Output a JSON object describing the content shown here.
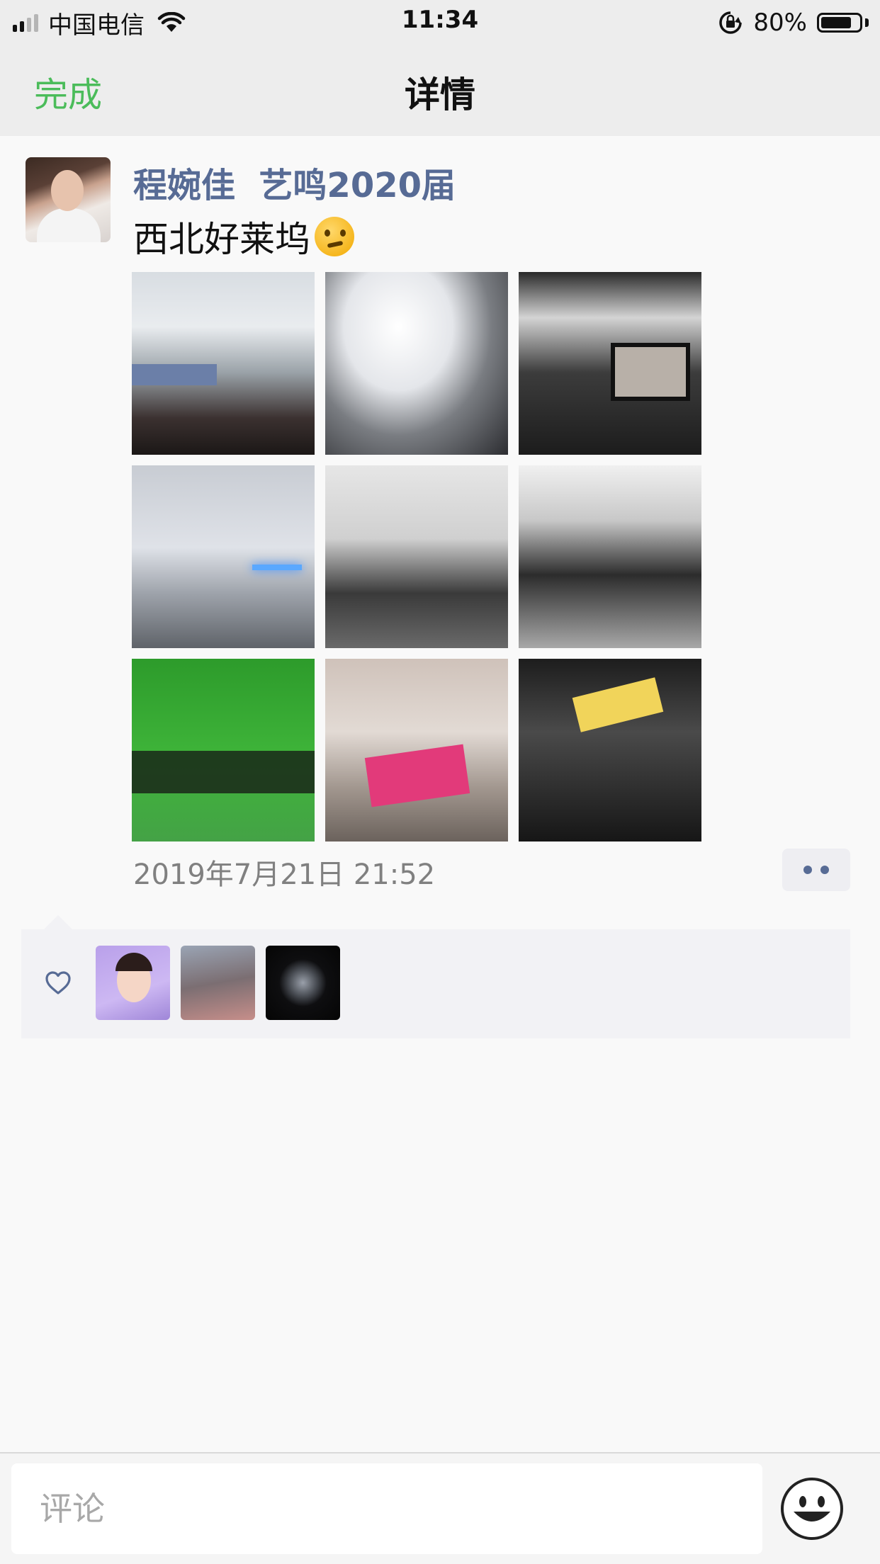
{
  "status_bar": {
    "carrier": "中国电信",
    "time": "11:34",
    "battery": "80%",
    "battery_level": 0.8,
    "icons": [
      "signal-icon",
      "wifi-icon",
      "orientation-lock-icon",
      "battery-icon"
    ]
  },
  "nav": {
    "done": "完成",
    "title": "详情",
    "done_color": "#4bbc5a"
  },
  "post": {
    "author": "程婉佳  艺鸣2020届",
    "author_color": "#576b95",
    "text": "西北好莱坞",
    "emoji": "thinking-face-emoji",
    "photo_count": 9,
    "timestamp": "2019年7月21日 21:52"
  },
  "likes": {
    "icon": "heart-outline-icon",
    "liker_count": 3
  },
  "comment": {
    "placeholder": "评论",
    "value": "",
    "emoji_button": "smiley-icon"
  }
}
